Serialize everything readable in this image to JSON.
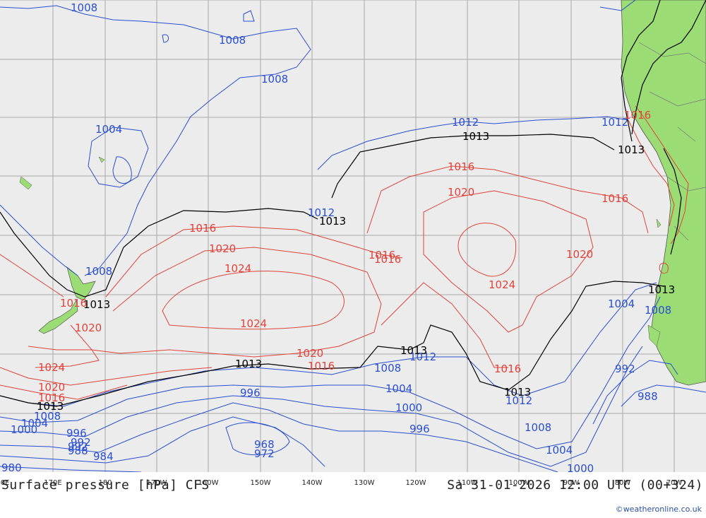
{
  "footer": {
    "title": "Surface pressure [hPa] CFS",
    "datetime": "Sa 31-01-2026 12:00 UTC (00+324)",
    "credit": "©weatheronline.co.uk"
  },
  "axis": {
    "lon_labels": [
      "60E",
      "170E",
      "180",
      "170W",
      "160W",
      "150W",
      "140W",
      "130W",
      "120W",
      "110W",
      "100W",
      "90W",
      "80W",
      "70W"
    ]
  },
  "isobar_labels": {
    "blue": [
      "1008",
      "1008",
      "1008",
      "1004",
      "1008",
      "1012",
      "1012",
      "1012",
      "1012",
      "1008",
      "1004",
      "1000",
      "996",
      "992",
      "988",
      "984",
      "980",
      "968",
      "972",
      "996",
      "992",
      "1008",
      "1004",
      "1000",
      "996",
      "1008",
      "1004",
      "1000",
      "1004",
      "1008",
      "992",
      "988",
      "1012"
    ],
    "red": [
      "1016",
      "1016",
      "1016",
      "1020",
      "1020",
      "1024",
      "1024",
      "1024",
      "1020",
      "1016",
      "1016",
      "1020",
      "1016",
      "1016",
      "1024",
      "1020",
      "1016",
      "1016",
      "1016",
      "1020"
    ],
    "black": [
      "1013",
      "1013",
      "1013",
      "1013",
      "1013",
      "1013",
      "1013",
      "1013",
      "1013",
      "1013"
    ]
  },
  "colors": {
    "sea": "#ececec",
    "land": "#9bdc74",
    "grid": "#a8a8a8",
    "isobar_low": "#2a4fd0",
    "isobar_high": "#e0433a",
    "isobar_ref": "#000000"
  }
}
